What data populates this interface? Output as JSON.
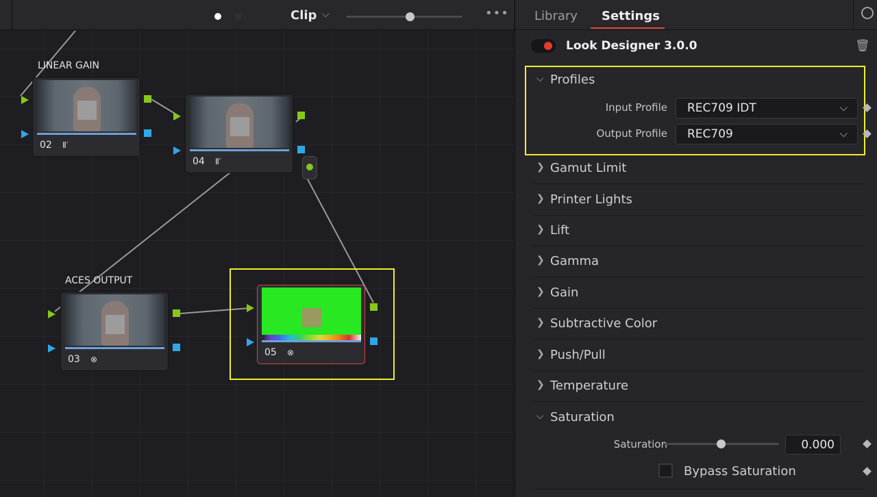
{
  "node_toolbar": {
    "title": "Clip",
    "zoom_percent": 55,
    "more_icon": "more-horizontal-icon"
  },
  "nodes": [
    {
      "id": "02",
      "label": "LINEAR GAIN",
      "icon": "bars-icon",
      "icon_glyph": "Ⅱ′"
    },
    {
      "id": "04",
      "label": "",
      "icon": "bars-icon",
      "icon_glyph": "Ⅱ′"
    },
    {
      "id": "03",
      "label": "ACES OUTPUT",
      "icon": "ofx-icon",
      "icon_glyph": "⊗"
    },
    {
      "id": "05",
      "label": "",
      "icon": "ofx-icon",
      "icon_glyph": "⊗",
      "selected": true
    }
  ],
  "inspector": {
    "tabs": {
      "library": "Library",
      "settings": "Settings"
    },
    "active_tab": "Settings",
    "plugin": {
      "title": "Look Designer 3.0.0",
      "enabled": true
    },
    "profiles": {
      "section_label": "Profiles",
      "input_label": "Input Profile",
      "input_value": "REC709 IDT",
      "output_label": "Output Profile",
      "output_value": "REC709"
    },
    "sections": [
      "Gamut Limit",
      "Printer Lights",
      "Lift",
      "Gamma",
      "Gain",
      "Subtractive Color",
      "Push/Pull",
      "Temperature"
    ],
    "saturation": {
      "section_label": "Saturation",
      "field_label": "Saturation",
      "value": "0.000",
      "slider_percent": 50,
      "bypass_label": "Bypass Saturation",
      "bypass_checked": false
    }
  },
  "colors": {
    "accent_red": "#d94a3c",
    "highlight_yellow": "#f2ee2b",
    "port_green": "#86c81a",
    "port_blue": "#2fa8e8"
  }
}
